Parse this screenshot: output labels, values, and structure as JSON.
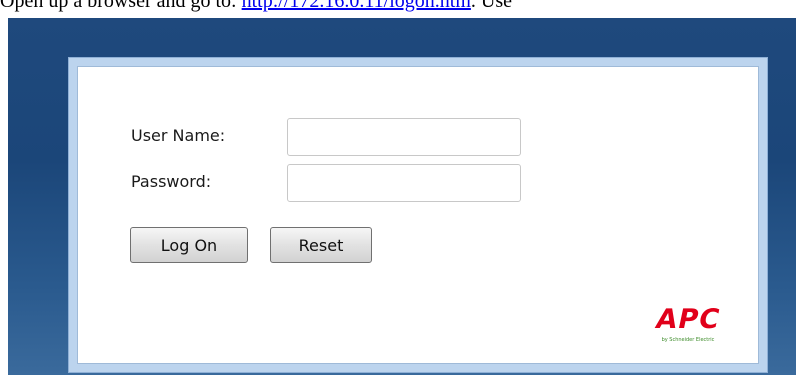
{
  "top_line": {
    "prefix": "Open up a browser and go to:",
    "link": "http://172.16.0.11/logon.htm",
    "suffix": "Use"
  },
  "login_form": {
    "username_label": "User Name:",
    "username_value": "",
    "password_label": "Password:",
    "password_value": "",
    "logon_button": "Log On",
    "reset_button": "Reset"
  },
  "logo": {
    "text": "APC",
    "tagline": "by Schneider Electric",
    "color": "#e1001a"
  },
  "colors": {
    "background_blue": "#1f497d",
    "frame_light_blue": "#bcd4ee"
  }
}
